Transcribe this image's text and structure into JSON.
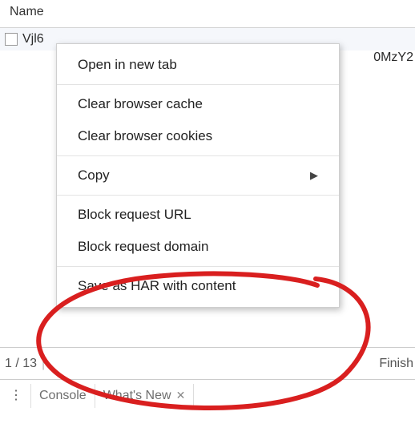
{
  "header": {
    "column_label": "Name"
  },
  "row": {
    "name_left_fragment": "Vjl6",
    "name_right_fragment": "0MzY2"
  },
  "context_menu": {
    "open_new_tab": "Open in new tab",
    "clear_cache": "Clear browser cache",
    "clear_cookies": "Clear browser cookies",
    "copy": "Copy",
    "block_url": "Block request URL",
    "block_domain": "Block request domain",
    "save_har": "Save as HAR with content"
  },
  "status_bar": {
    "fragment_left": "1 / 13",
    "fragment_right": "Finish"
  },
  "tabs": {
    "console": "Console",
    "whats_new": "What's New"
  }
}
